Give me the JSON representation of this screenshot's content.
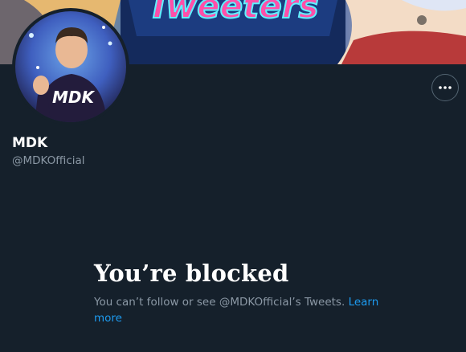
{
  "profile": {
    "display_name": "MDK",
    "handle": "@MDKOfficial",
    "banner_text": "Tweeters",
    "avatar_logo_text": "MDK"
  },
  "blocked": {
    "title": "You’re blocked",
    "description": "You can’t follow or see @MDKOfficial’s Tweets.",
    "link_label": "Learn more"
  },
  "icons": {
    "more": "more-options-icon"
  },
  "colors": {
    "background": "#15202b",
    "primary_text": "#ffffff",
    "secondary_text": "#8b98a5",
    "link": "#1d9bf0",
    "button_border": "#536471"
  }
}
